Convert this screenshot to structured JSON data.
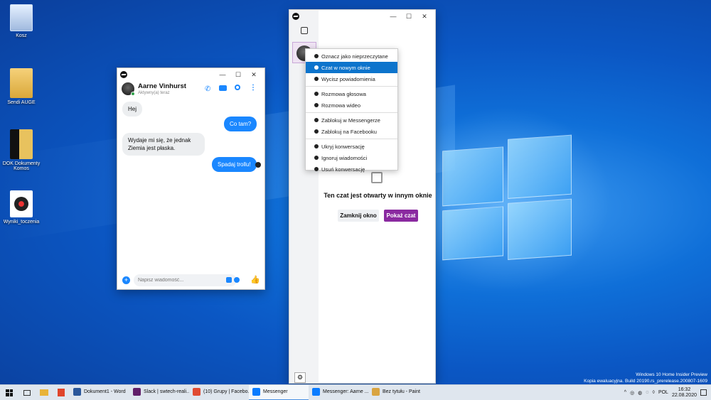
{
  "desktop": {
    "icons": [
      {
        "label": "Kosz",
        "icon": "recycle-bin-icon"
      },
      {
        "label": "Sendi AUGE",
        "icon": "folder-icon"
      },
      {
        "label": "DOK Dokumenty Komos",
        "icon": "folder-icon"
      },
      {
        "label": "Wyniki_toczenia",
        "icon": "media-file-icon"
      }
    ],
    "watermark": {
      "line1": "Windows 10 Home Insider Preview",
      "line2": "Kopia ewaluacyjna. Build 20190.rs_prerelease.200807-1609"
    }
  },
  "chat_window": {
    "contact_name": "Aarne Vinhurst",
    "status": "Aktywny(a) teraz",
    "messages": [
      {
        "dir": "in",
        "text": "Hej"
      },
      {
        "dir": "out",
        "text": "Co tam?"
      },
      {
        "dir": "in",
        "text": "Wydaje mi się, że jednak Ziemia jest płaska."
      },
      {
        "dir": "out",
        "text": "Spadaj trollu!"
      }
    ],
    "input_placeholder": "Napisz wiadomość..."
  },
  "messenger_window": {
    "context_menu": [
      {
        "label": "Oznacz jako nieprzeczytane",
        "icon": "chat-bubble-icon",
        "selected": false
      },
      {
        "label": "Czat w nowym oknie",
        "icon": "external-link-icon",
        "selected": true
      },
      {
        "label": "Wycisz powiadomienia",
        "icon": "bell-icon",
        "selected": false
      },
      {
        "separator": true
      },
      {
        "label": "Rozmowa głosowa",
        "icon": "phone-icon",
        "selected": false
      },
      {
        "label": "Rozmowa wideo",
        "icon": "video-icon",
        "selected": false
      },
      {
        "separator": true
      },
      {
        "label": "Zablokuj w Messengerze",
        "icon": "block-icon",
        "selected": false
      },
      {
        "label": "Zablokuj na Facebooku",
        "icon": "block-icon",
        "selected": false
      },
      {
        "separator": true
      },
      {
        "label": "Ukryj konwersację",
        "icon": "hide-icon",
        "selected": false
      },
      {
        "label": "Ignoruj wiadomości",
        "icon": "ignore-icon",
        "selected": false
      },
      {
        "label": "Usuń konwersację",
        "icon": "trash-icon",
        "selected": false
      }
    ],
    "open_elsewhere_text": "Ten czat jest otwarty w innym oknie",
    "close_window_label": "Zamknij okno",
    "show_chat_label": "Pokaż czat"
  },
  "taskbar": {
    "apps": [
      {
        "label": "Dokument1 - Word",
        "color": "#2b579a",
        "active": false
      },
      {
        "label": "Slack | swtech-reali...",
        "color": "#611f69",
        "active": false
      },
      {
        "label": "(10) Grupy | Facebo...",
        "color": "#e04b32",
        "active": false
      },
      {
        "label": "Messenger",
        "color": "#0a7cff",
        "active": true
      },
      {
        "label": "Messenger: Aarne ...",
        "color": "#0a7cff",
        "active": false
      },
      {
        "label": "Bez tytułu - Paint",
        "color": "#d9a441",
        "active": false
      }
    ],
    "language": "POL",
    "time": "16:32",
    "date": "22.08.2020"
  },
  "colors": {
    "messenger_blue": "#1a87ff",
    "menu_selected": "#0d74cc",
    "show_chat_button": "#8a2aa0"
  }
}
